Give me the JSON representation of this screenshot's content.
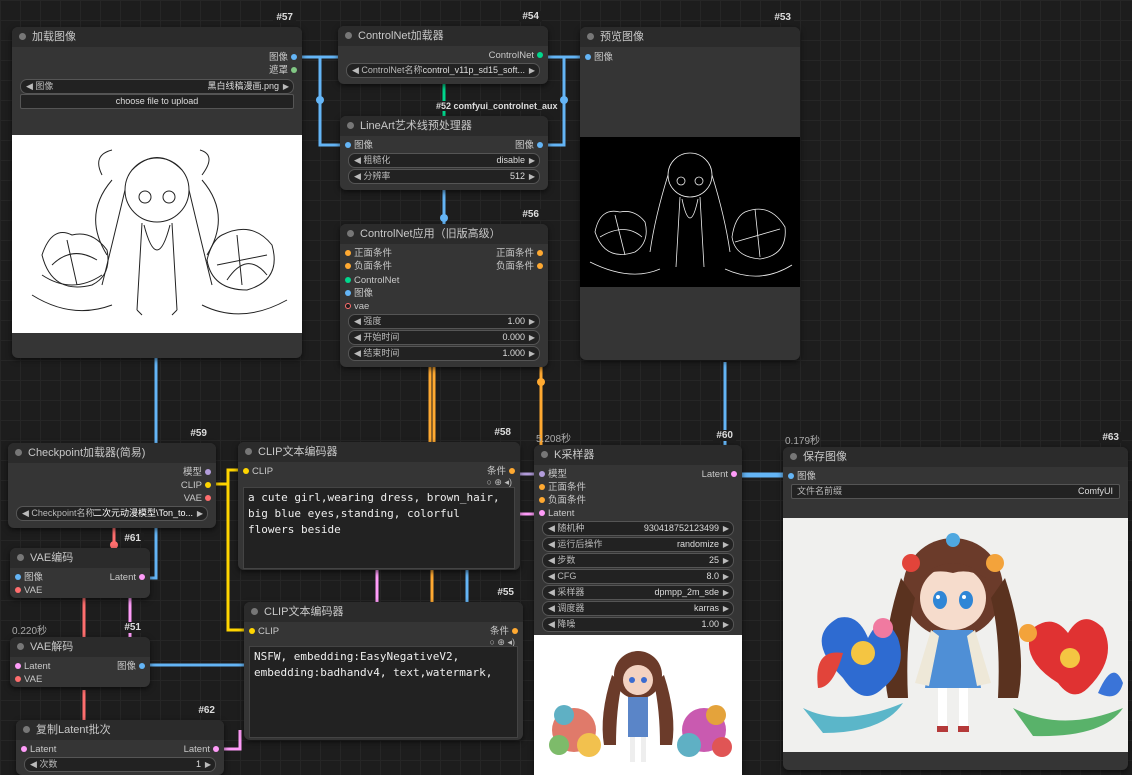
{
  "colors": {
    "model": "#b39ddb",
    "clip": "#ffd500",
    "vae": "#ff6e6e",
    "conditioning": "#ffa931",
    "latent": "#ff9cf9",
    "image": "#64b5f6",
    "mask": "#81c784",
    "controlnet": "#00d78d"
  },
  "nodes": {
    "load_image": {
      "id": "#57",
      "title": "加载图像",
      "out_image": "图像",
      "out_mask": "遮罩",
      "w_image_label": "图像",
      "w_image_value": "黑白线稿漫画.png",
      "upload": "choose file to upload"
    },
    "controlnet_loader": {
      "id": "#54",
      "title": "ControlNet加载器",
      "out": "ControlNet",
      "w_label": "ControlNet名称",
      "w_value": "control_v11p_sd15_soft..."
    },
    "preview": {
      "id": "#53",
      "title": "预览图像",
      "in_image": "图像"
    },
    "lineart": {
      "group": "#52 comfyui_controlnet_aux",
      "title": "LineArt艺术线预处理器",
      "in_image": "图像",
      "out_image": "图像",
      "w1_label": "粗糙化",
      "w1_value": "disable",
      "w2_label": "分辨率",
      "w2_value": "512"
    },
    "cn_apply": {
      "id": "#56",
      "title": "ControlNet应用（旧版高级）",
      "in_pos": "正面条件",
      "in_neg": "负面条件",
      "in_cn": "ControlNet",
      "in_image": "图像",
      "in_vae": "vae",
      "out_pos": "正面条件",
      "out_neg": "负面条件",
      "w1_label": "强度",
      "w1_value": "1.00",
      "w2_label": "开始时间",
      "w2_value": "0.000",
      "w3_label": "结束时间",
      "w3_value": "1.000"
    },
    "checkpoint": {
      "id": "#59",
      "title": "Checkpoint加载器(简易)",
      "out_model": "模型",
      "out_clip": "CLIP",
      "out_vae": "VAE",
      "w_label": "Checkpoint名称",
      "w_value": "二次元动漫模型\\Ton_to..."
    },
    "clip_pos": {
      "id": "#58",
      "title": "CLIP文本编码器",
      "in_clip": "CLIP",
      "out": "条件",
      "text": "a cute girl,wearing dress, brown_hair,\nbig blue eyes,standing, colorful\nflowers beside"
    },
    "ksampler": {
      "id": "#60",
      "timing": "5.208秒",
      "title": "K采样器",
      "in_model": "模型",
      "in_pos": "正面条件",
      "in_neg": "负面条件",
      "in_latent": "Latent",
      "out": "Latent",
      "widgets": [
        {
          "label": "随机种",
          "value": "930418752123499"
        },
        {
          "label": "运行后操作",
          "value": "randomize"
        },
        {
          "label": "步数",
          "value": "25"
        },
        {
          "label": "CFG",
          "value": "8.0"
        },
        {
          "label": "采样器",
          "value": "dpmpp_2m_sde"
        },
        {
          "label": "调度器",
          "value": "karras"
        },
        {
          "label": "降噪",
          "value": "1.00"
        }
      ]
    },
    "save": {
      "id": "#63",
      "timing": "0.179秒",
      "title": "保存图像",
      "in_image": "图像",
      "w_label": "文件名前缀",
      "w_value": "ComfyUI"
    },
    "vae_encode": {
      "id": "#61",
      "title": "VAE编码",
      "in_image": "图像",
      "in_vae": "VAE",
      "out": "Latent"
    },
    "vae_decode": {
      "id": "#51",
      "timing": "0.220秒",
      "title": "VAE解码",
      "in_latent": "Latent",
      "in_vae": "VAE",
      "out": "图像"
    },
    "clip_neg": {
      "id": "#55",
      "title": "CLIP文本编码器",
      "in_clip": "CLIP",
      "out": "条件",
      "text": "NSFW, embedding:EasyNegativeV2,\nembedding:badhandv4, text,watermark,"
    },
    "repeat_latent": {
      "id": "#62",
      "title": "复制Latent批次",
      "in": "Latent",
      "out": "Latent",
      "w_label": "次数",
      "w_value": "1"
    }
  }
}
